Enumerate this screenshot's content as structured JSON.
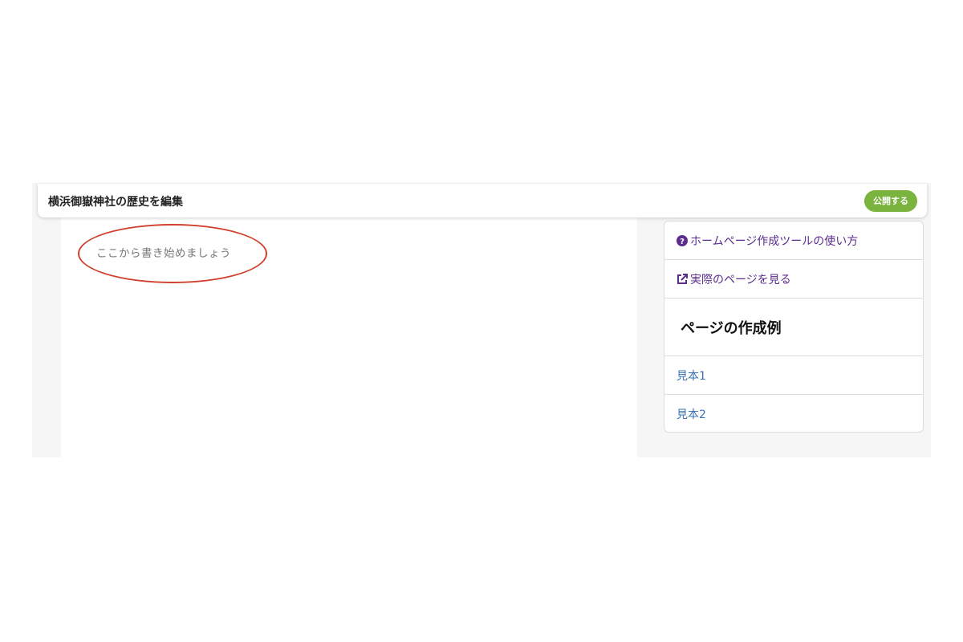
{
  "header": {
    "title": "横浜御嶽神社の歴史を編集",
    "publish_label": "公開する"
  },
  "editor": {
    "placeholder": "ここから書き始めましょう"
  },
  "sidebar": {
    "help_link": "ホームページ作成ツールの使い方",
    "view_page_link": "実際のページを見る",
    "examples_heading": "ページの作成例",
    "examples": [
      "見本1",
      "見本2"
    ]
  },
  "colors": {
    "publish_button": "#7ab33e",
    "link_purple": "#5b2d8f",
    "link_blue": "#3a6fb0",
    "annotation_oval": "#d0412e"
  },
  "icons": [
    "question-circle-icon",
    "external-link-icon"
  ]
}
